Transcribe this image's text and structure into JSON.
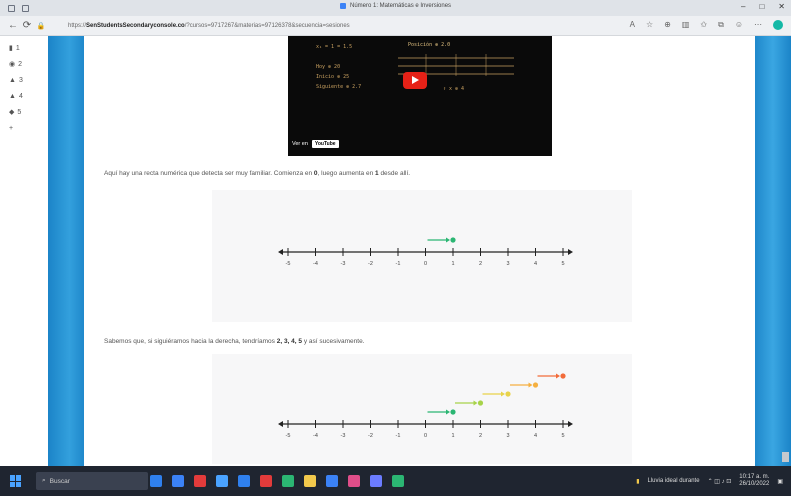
{
  "browser": {
    "tab_title": "Número 1: Matemáticas e Inversiones",
    "url_domain": "SenStudentsSecondaryconsole.co",
    "url_rest": "/?cursos=9717267&materias=97126378&secuencia=sesiones",
    "url_prefix": "https://"
  },
  "sidebar": {
    "items": [
      "1",
      "2",
      "3",
      "4",
      "5",
      "6"
    ]
  },
  "video": {
    "watch_on": "Ver en",
    "youtube": "YouTube",
    "lines": [
      "x₁ = 1 = 1.5",
      "Posición ⊕ 2.0",
      "Hoy  ⊕ 20",
      "Inicio  ⊕ 25",
      "Siguiente  ⊕ 2.7",
      "↑ x ⊕ 4"
    ]
  },
  "paragraph1": {
    "before": "Aquí hay una recta numérica que detecta ser muy familiar. Comienza en ",
    "bold1": "0",
    "middle": ", luego aumenta en ",
    "bold2": "1",
    "after": " desde allí."
  },
  "paragraph2": {
    "before": "Sabemos que, si siguiéramos hacia la derecha, tendríamos ",
    "bold": "2, 3, 4, 5",
    "after": " y así sucesivamente."
  },
  "number_line_ticks": [
    "-5",
    "-4",
    "-3",
    "-2",
    "-1",
    "0",
    "1",
    "2",
    "3",
    "4",
    "5"
  ],
  "number_line_1": {
    "arrows": [
      {
        "from": 0,
        "to": 1,
        "color": "#2bb673"
      }
    ]
  },
  "number_line_2": {
    "arrows": [
      {
        "from": 0,
        "to": 1,
        "color": "#2bb673"
      },
      {
        "from": 1,
        "to": 2,
        "color": "#a7d34a"
      },
      {
        "from": 2,
        "to": 3,
        "color": "#e8d34a"
      },
      {
        "from": 3,
        "to": 4,
        "color": "#f5b041"
      },
      {
        "from": 4,
        "to": 5,
        "color": "#f26b3a"
      }
    ]
  },
  "taskbar": {
    "search_placeholder": "Buscar",
    "weather": "Lluvia ideal durante",
    "time": "10:17 a. m.",
    "date": "26/10/2022",
    "app_colors": [
      "#2f80ed",
      "#3b82f6",
      "#e23b3b",
      "#4aa3ff",
      "#2f80ed",
      "#e23b3b",
      "#2bb673",
      "#f2c94c",
      "#3b82f6",
      "#e04e8a",
      "#6b7cff",
      "#2bb673"
    ]
  }
}
